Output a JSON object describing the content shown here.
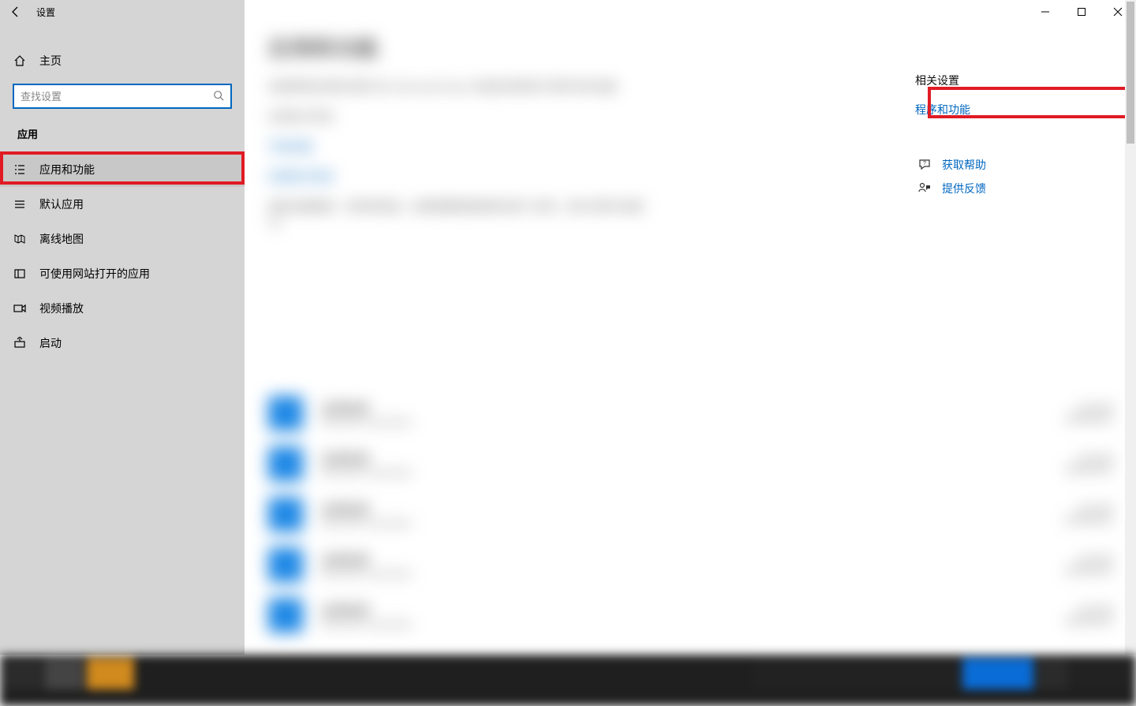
{
  "window": {
    "title": "设置"
  },
  "sidebar": {
    "home": "主页",
    "search_placeholder": "查找设置",
    "section": "应用",
    "items": [
      {
        "label": "应用和功能"
      },
      {
        "label": "默认应用"
      },
      {
        "label": "离线地图"
      },
      {
        "label": "可使用网站打开的应用"
      },
      {
        "label": "视频播放"
      },
      {
        "label": "启动"
      }
    ]
  },
  "right": {
    "heading": "相关设置",
    "link1": "程序和功能",
    "help": "获取帮助",
    "feedback": "提供反馈"
  }
}
